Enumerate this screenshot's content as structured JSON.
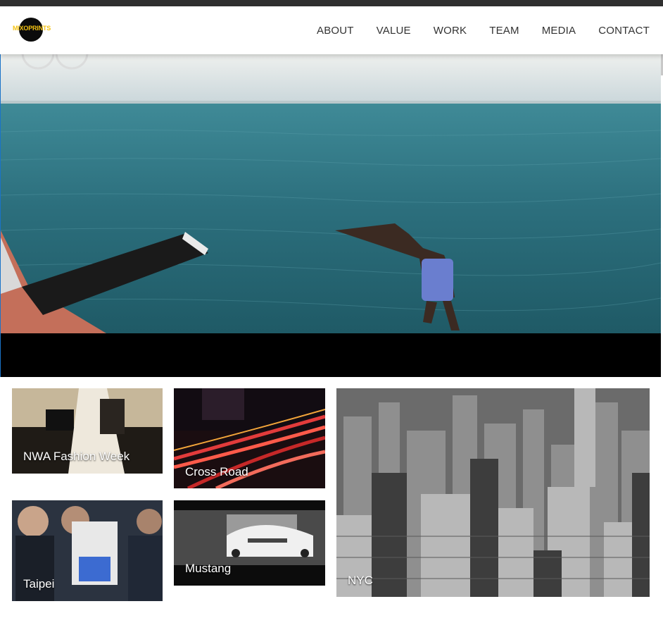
{
  "brand": {
    "logo_text": "MIXOPRINTS"
  },
  "nav": {
    "items": [
      {
        "label": "ABOUT"
      },
      {
        "label": "VALUE"
      },
      {
        "label": "WORK"
      },
      {
        "label": "TEAM"
      },
      {
        "label": "MEDIA"
      },
      {
        "label": "CONTACT"
      }
    ]
  },
  "gallery": {
    "tiles": [
      {
        "caption": "NWA Fashion Week"
      },
      {
        "caption": "Cross Road"
      },
      {
        "caption": "NYC"
      },
      {
        "caption": "Taipei"
      },
      {
        "caption": "Mustang"
      }
    ]
  },
  "colors": {
    "logo_accent": "#f4c211",
    "nav_text": "#333333",
    "topbar": "#2f2f2f"
  }
}
